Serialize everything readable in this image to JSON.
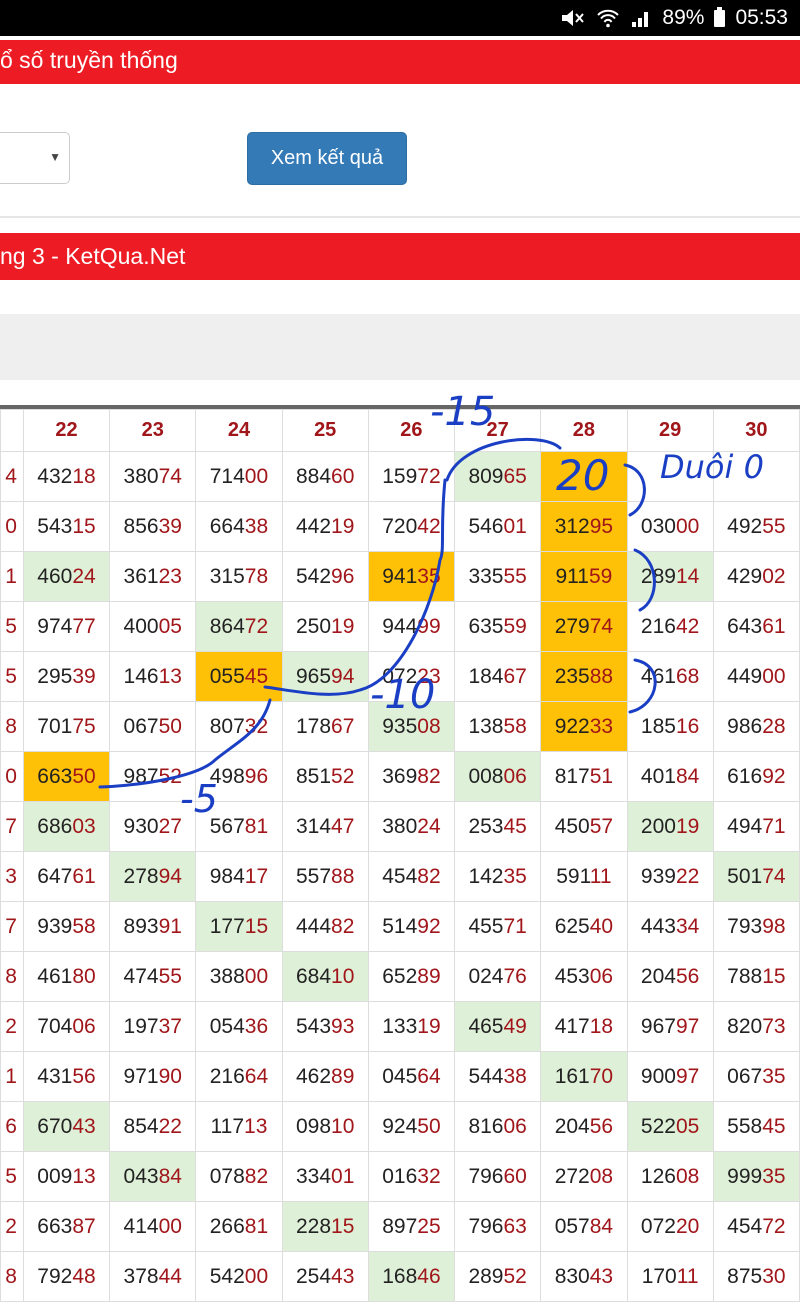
{
  "status_bar": {
    "battery": "89%",
    "time": "05:53",
    "icons": [
      "mute-icon",
      "wifi-icon",
      "signal-icon",
      "battery-icon"
    ]
  },
  "header_title": "ổ số truyền thống",
  "button_label": "Xem kết quả",
  "section_title": "ng 3 - KetQua.Net",
  "table": {
    "columns": [
      "22",
      "23",
      "24",
      "25",
      "26",
      "27",
      "28",
      "29",
      "30"
    ],
    "rows": [
      {
        "edge": "4",
        "cells": [
          {
            "a": "432",
            "b": "18",
            "bg": ""
          },
          {
            "a": "380",
            "b": "74",
            "bg": ""
          },
          {
            "a": "714",
            "b": "00",
            "bg": ""
          },
          {
            "a": "884",
            "b": "60",
            "bg": ""
          },
          {
            "a": "159",
            "b": "72",
            "bg": ""
          },
          {
            "a": "809",
            "b": "65",
            "bg": "g"
          },
          {
            "a": "",
            "b": "",
            "bg": "o"
          },
          {
            "a": "",
            "b": "",
            "bg": ""
          },
          {
            "a": "",
            "b": "",
            "bg": ""
          }
        ]
      },
      {
        "edge": "0",
        "cells": [
          {
            "a": "543",
            "b": "15",
            "bg": ""
          },
          {
            "a": "856",
            "b": "39",
            "bg": ""
          },
          {
            "a": "664",
            "b": "38",
            "bg": ""
          },
          {
            "a": "442",
            "b": "19",
            "bg": ""
          },
          {
            "a": "720",
            "b": "42",
            "bg": ""
          },
          {
            "a": "546",
            "b": "01",
            "bg": ""
          },
          {
            "a": "312",
            "b": "95",
            "bg": "o"
          },
          {
            "a": "030",
            "b": "00",
            "bg": ""
          },
          {
            "a": "492",
            "b": "55",
            "bg": ""
          }
        ]
      },
      {
        "edge": "1",
        "cells": [
          {
            "a": "460",
            "b": "24",
            "bg": "g"
          },
          {
            "a": "361",
            "b": "23",
            "bg": ""
          },
          {
            "a": "315",
            "b": "78",
            "bg": ""
          },
          {
            "a": "542",
            "b": "96",
            "bg": ""
          },
          {
            "a": "941",
            "b": "35",
            "bg": "o"
          },
          {
            "a": "335",
            "b": "55",
            "bg": ""
          },
          {
            "a": "911",
            "b": "59",
            "bg": "o"
          },
          {
            "a": "289",
            "b": "14",
            "bg": "g"
          },
          {
            "a": "429",
            "b": "02",
            "bg": ""
          }
        ]
      },
      {
        "edge": "5",
        "cells": [
          {
            "a": "974",
            "b": "77",
            "bg": ""
          },
          {
            "a": "400",
            "b": "05",
            "bg": ""
          },
          {
            "a": "864",
            "b": "72",
            "bg": "g"
          },
          {
            "a": "250",
            "b": "19",
            "bg": ""
          },
          {
            "a": "944",
            "b": "99",
            "bg": ""
          },
          {
            "a": "635",
            "b": "59",
            "bg": ""
          },
          {
            "a": "279",
            "b": "74",
            "bg": "o"
          },
          {
            "a": "216",
            "b": "42",
            "bg": ""
          },
          {
            "a": "643",
            "b": "61",
            "bg": ""
          }
        ]
      },
      {
        "edge": "5",
        "cells": [
          {
            "a": "295",
            "b": "39",
            "bg": ""
          },
          {
            "a": "146",
            "b": "13",
            "bg": ""
          },
          {
            "a": "055",
            "b": "45",
            "bg": "o"
          },
          {
            "a": "965",
            "b": "94",
            "bg": "g"
          },
          {
            "a": "072",
            "b": "23",
            "bg": ""
          },
          {
            "a": "184",
            "b": "67",
            "bg": ""
          },
          {
            "a": "235",
            "b": "88",
            "bg": "o"
          },
          {
            "a": "461",
            "b": "68",
            "bg": ""
          },
          {
            "a": "449",
            "b": "00",
            "bg": ""
          }
        ]
      },
      {
        "edge": "8",
        "cells": [
          {
            "a": "701",
            "b": "75",
            "bg": ""
          },
          {
            "a": "067",
            "b": "50",
            "bg": ""
          },
          {
            "a": "807",
            "b": "32",
            "bg": ""
          },
          {
            "a": "178",
            "b": "67",
            "bg": ""
          },
          {
            "a": "935",
            "b": "08",
            "bg": "g"
          },
          {
            "a": "138",
            "b": "58",
            "bg": ""
          },
          {
            "a": "922",
            "b": "33",
            "bg": "o"
          },
          {
            "a": "185",
            "b": "16",
            "bg": ""
          },
          {
            "a": "986",
            "b": "28",
            "bg": ""
          }
        ]
      },
      {
        "edge": "0",
        "cells": [
          {
            "a": "663",
            "b": "50",
            "bg": "o"
          },
          {
            "a": "987",
            "b": "52",
            "bg": ""
          },
          {
            "a": "498",
            "b": "96",
            "bg": ""
          },
          {
            "a": "851",
            "b": "52",
            "bg": ""
          },
          {
            "a": "369",
            "b": "82",
            "bg": ""
          },
          {
            "a": "008",
            "b": "06",
            "bg": "g"
          },
          {
            "a": "817",
            "b": "51",
            "bg": ""
          },
          {
            "a": "401",
            "b": "84",
            "bg": ""
          },
          {
            "a": "616",
            "b": "92",
            "bg": ""
          }
        ]
      },
      {
        "edge": "7",
        "cells": [
          {
            "a": "686",
            "b": "03",
            "bg": "g"
          },
          {
            "a": "930",
            "b": "27",
            "bg": ""
          },
          {
            "a": "567",
            "b": "81",
            "bg": ""
          },
          {
            "a": "314",
            "b": "47",
            "bg": ""
          },
          {
            "a": "380",
            "b": "24",
            "bg": ""
          },
          {
            "a": "253",
            "b": "45",
            "bg": ""
          },
          {
            "a": "450",
            "b": "57",
            "bg": ""
          },
          {
            "a": "200",
            "b": "19",
            "bg": "g"
          },
          {
            "a": "494",
            "b": "71",
            "bg": ""
          }
        ]
      },
      {
        "edge": "3",
        "cells": [
          {
            "a": "647",
            "b": "61",
            "bg": ""
          },
          {
            "a": "278",
            "b": "94",
            "bg": "g"
          },
          {
            "a": "984",
            "b": "17",
            "bg": ""
          },
          {
            "a": "557",
            "b": "88",
            "bg": ""
          },
          {
            "a": "454",
            "b": "82",
            "bg": ""
          },
          {
            "a": "142",
            "b": "35",
            "bg": ""
          },
          {
            "a": "591",
            "b": "11",
            "bg": ""
          },
          {
            "a": "939",
            "b": "22",
            "bg": ""
          },
          {
            "a": "501",
            "b": "74",
            "bg": "g"
          }
        ]
      },
      {
        "edge": "7",
        "cells": [
          {
            "a": "939",
            "b": "58",
            "bg": ""
          },
          {
            "a": "893",
            "b": "91",
            "bg": ""
          },
          {
            "a": "177",
            "b": "15",
            "bg": "g"
          },
          {
            "a": "444",
            "b": "82",
            "bg": ""
          },
          {
            "a": "514",
            "b": "92",
            "bg": ""
          },
          {
            "a": "455",
            "b": "71",
            "bg": ""
          },
          {
            "a": "625",
            "b": "40",
            "bg": ""
          },
          {
            "a": "443",
            "b": "34",
            "bg": ""
          },
          {
            "a": "793",
            "b": "98",
            "bg": ""
          }
        ]
      },
      {
        "edge": "8",
        "cells": [
          {
            "a": "461",
            "b": "80",
            "bg": ""
          },
          {
            "a": "474",
            "b": "55",
            "bg": ""
          },
          {
            "a": "388",
            "b": "00",
            "bg": ""
          },
          {
            "a": "684",
            "b": "10",
            "bg": "g"
          },
          {
            "a": "652",
            "b": "89",
            "bg": ""
          },
          {
            "a": "024",
            "b": "76",
            "bg": ""
          },
          {
            "a": "453",
            "b": "06",
            "bg": ""
          },
          {
            "a": "204",
            "b": "56",
            "bg": ""
          },
          {
            "a": "788",
            "b": "15",
            "bg": ""
          }
        ]
      },
      {
        "edge": "2",
        "cells": [
          {
            "a": "704",
            "b": "06",
            "bg": ""
          },
          {
            "a": "197",
            "b": "37",
            "bg": ""
          },
          {
            "a": "054",
            "b": "36",
            "bg": ""
          },
          {
            "a": "543",
            "b": "93",
            "bg": ""
          },
          {
            "a": "133",
            "b": "19",
            "bg": ""
          },
          {
            "a": "465",
            "b": "49",
            "bg": "g"
          },
          {
            "a": "417",
            "b": "18",
            "bg": ""
          },
          {
            "a": "967",
            "b": "97",
            "bg": ""
          },
          {
            "a": "820",
            "b": "73",
            "bg": ""
          }
        ]
      },
      {
        "edge": "1",
        "cells": [
          {
            "a": "431",
            "b": "56",
            "bg": ""
          },
          {
            "a": "971",
            "b": "90",
            "bg": ""
          },
          {
            "a": "216",
            "b": "64",
            "bg": ""
          },
          {
            "a": "462",
            "b": "89",
            "bg": ""
          },
          {
            "a": "045",
            "b": "64",
            "bg": ""
          },
          {
            "a": "544",
            "b": "38",
            "bg": ""
          },
          {
            "a": "161",
            "b": "70",
            "bg": "g"
          },
          {
            "a": "900",
            "b": "97",
            "bg": ""
          },
          {
            "a": "067",
            "b": "35",
            "bg": ""
          }
        ]
      },
      {
        "edge": "6",
        "cells": [
          {
            "a": "670",
            "b": "43",
            "bg": "g"
          },
          {
            "a": "854",
            "b": "22",
            "bg": ""
          },
          {
            "a": "117",
            "b": "13",
            "bg": ""
          },
          {
            "a": "098",
            "b": "10",
            "bg": ""
          },
          {
            "a": "924",
            "b": "50",
            "bg": ""
          },
          {
            "a": "816",
            "b": "06",
            "bg": ""
          },
          {
            "a": "204",
            "b": "56",
            "bg": ""
          },
          {
            "a": "522",
            "b": "05",
            "bg": "g"
          },
          {
            "a": "558",
            "b": "45",
            "bg": ""
          }
        ]
      },
      {
        "edge": "5",
        "cells": [
          {
            "a": "009",
            "b": "13",
            "bg": ""
          },
          {
            "a": "043",
            "b": "84",
            "bg": "g"
          },
          {
            "a": "078",
            "b": "82",
            "bg": ""
          },
          {
            "a": "334",
            "b": "01",
            "bg": ""
          },
          {
            "a": "016",
            "b": "32",
            "bg": ""
          },
          {
            "a": "796",
            "b": "60",
            "bg": ""
          },
          {
            "a": "272",
            "b": "08",
            "bg": ""
          },
          {
            "a": "126",
            "b": "08",
            "bg": ""
          },
          {
            "a": "999",
            "b": "35",
            "bg": "g"
          }
        ]
      },
      {
        "edge": "2",
        "cells": [
          {
            "a": "663",
            "b": "87",
            "bg": ""
          },
          {
            "a": "414",
            "b": "00",
            "bg": ""
          },
          {
            "a": "266",
            "b": "81",
            "bg": ""
          },
          {
            "a": "228",
            "b": "15",
            "bg": "g"
          },
          {
            "a": "897",
            "b": "25",
            "bg": ""
          },
          {
            "a": "796",
            "b": "63",
            "bg": ""
          },
          {
            "a": "057",
            "b": "84",
            "bg": ""
          },
          {
            "a": "072",
            "b": "20",
            "bg": ""
          },
          {
            "a": "454",
            "b": "72",
            "bg": ""
          }
        ]
      },
      {
        "edge": "8",
        "cells": [
          {
            "a": "792",
            "b": "48",
            "bg": ""
          },
          {
            "a": "378",
            "b": "44",
            "bg": ""
          },
          {
            "a": "542",
            "b": "00",
            "bg": ""
          },
          {
            "a": "254",
            "b": "43",
            "bg": ""
          },
          {
            "a": "168",
            "b": "46",
            "bg": "g"
          },
          {
            "a": "289",
            "b": "52",
            "bg": ""
          },
          {
            "a": "830",
            "b": "43",
            "bg": ""
          },
          {
            "a": "170",
            "b": "11",
            "bg": ""
          },
          {
            "a": "875",
            "b": "30",
            "bg": ""
          }
        ]
      }
    ]
  },
  "annotations": {
    "n1": "-15",
    "n2": "20",
    "n3": "Duôi 0",
    "n4": "-10",
    "n5": "-5"
  }
}
